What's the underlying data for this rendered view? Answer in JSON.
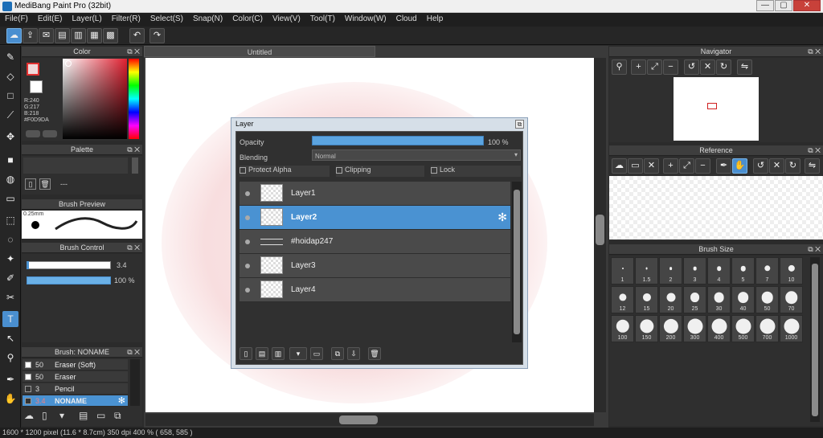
{
  "window": {
    "title": "MediBang Paint Pro (32bit)",
    "minimize": "—",
    "maximize": "▢",
    "close": "✕"
  },
  "menu": [
    "File(F)",
    "Edit(E)",
    "Layer(L)",
    "Filter(R)",
    "Select(S)",
    "Snap(N)",
    "Color(C)",
    "View(V)",
    "Tool(T)",
    "Window(W)",
    "Cloud",
    "Help"
  ],
  "colors": {
    "accent": "#4a92d2",
    "panel": "#2f2f2f",
    "foreground": "#f0d9da"
  },
  "color_panel": {
    "title": "Color",
    "r": "R:240",
    "g": "G:217",
    "b": "B:218",
    "hex": "#F0D9DA"
  },
  "palette_panel": {
    "title": "Palette",
    "empty": "---"
  },
  "brush_preview": {
    "title": "Brush Preview",
    "size": "0.25mm"
  },
  "brush_control": {
    "title": "Brush Control",
    "size_value": "3.4",
    "opacity_value": "100 %"
  },
  "brush_list": {
    "title": "Brush: NONAME",
    "items": [
      {
        "size": "50",
        "name": "Eraser (Soft)"
      },
      {
        "size": "50",
        "name": "Eraser"
      },
      {
        "size": "3",
        "name": "Pencil"
      },
      {
        "size": "3.4",
        "name": "NONAME"
      }
    ]
  },
  "canvas": {
    "tab_title": "Untitled"
  },
  "layer_dialog": {
    "title": "Layer",
    "opacity_label": "Opacity",
    "opacity_value": "100 %",
    "opacity": 1.0,
    "blending_label": "Blending",
    "blending_value": "Normal",
    "protect_alpha": "Protect Alpha",
    "clipping": "Clipping",
    "lock": "Lock",
    "layers": [
      {
        "name": "Layer1"
      },
      {
        "name": "Layer2"
      },
      {
        "name": "#hoidap247"
      },
      {
        "name": "Layer3"
      },
      {
        "name": "Layer4"
      }
    ]
  },
  "navigator": {
    "title": "Navigator"
  },
  "reference": {
    "title": "Reference"
  },
  "brush_size": {
    "title": "Brush Size",
    "sizes": [
      "1",
      "1.5",
      "2",
      "3",
      "4",
      "5",
      "7",
      "10",
      "12",
      "15",
      "20",
      "25",
      "30",
      "40",
      "50",
      "70",
      "100",
      "150",
      "200",
      "300",
      "400",
      "500",
      "700",
      "1000"
    ]
  },
  "status": "1600 * 1200 pixel   (11.6 * 8.7cm)   350 dpi   400 %   ( 658, 585 )"
}
